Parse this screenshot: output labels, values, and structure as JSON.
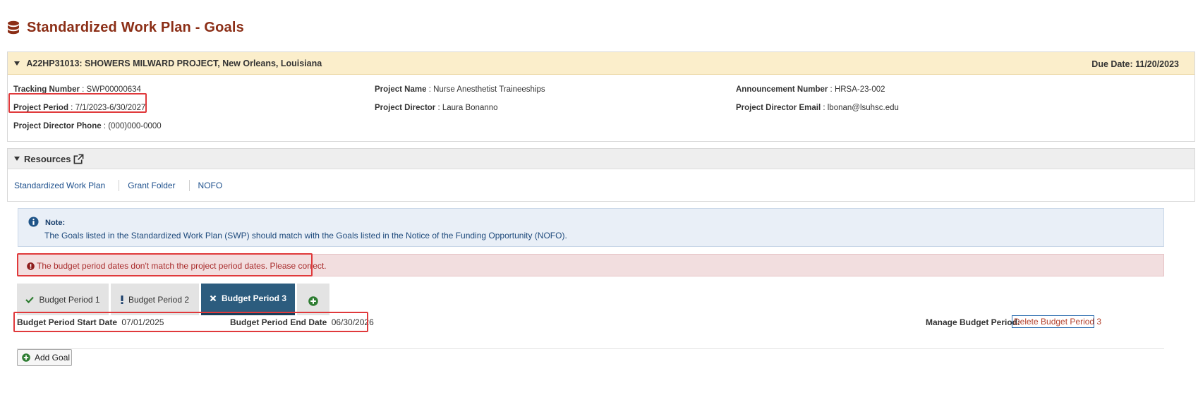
{
  "page": {
    "title": "Standardized Work Plan - Goals"
  },
  "project": {
    "header": "A22HP31013: SHOWERS MILWARD PROJECT, New Orleans, Louisiana",
    "due_date": "Due Date: 11/20/2023",
    "fields": {
      "tracking_number": {
        "label": "Tracking Number",
        "value": "SWP00000634"
      },
      "project_name": {
        "label": "Project Name",
        "value": "Nurse Anesthetist Traineeships"
      },
      "announcement_number": {
        "label": "Announcement Number",
        "value": "HRSA-23-002"
      },
      "project_period": {
        "label": "Project Period",
        "value": "7/1/2023-6/30/2027"
      },
      "project_director": {
        "label": "Project Director",
        "value": "Laura Bonanno"
      },
      "project_director_email": {
        "label": "Project Director Email",
        "value": "lbonan@lsuhsc.edu"
      },
      "project_director_phone": {
        "label": "Project Director Phone",
        "value": "(000)000-0000"
      }
    }
  },
  "resources": {
    "title": "Resources",
    "links": [
      "Standardized Work Plan",
      "Grant Folder",
      "NOFO"
    ]
  },
  "note": {
    "label": "Note:",
    "text": "The Goals listed in the Standardized Work Plan (SWP) should match with the Goals listed in the Notice of the Funding Opportunity (NOFO)."
  },
  "error": {
    "text": "The budget period dates don't match the project period dates. Please correct."
  },
  "tabs": [
    {
      "label": "Budget Period 1",
      "status": "check"
    },
    {
      "label": "Budget Period 2",
      "status": "warning"
    },
    {
      "label": "Budget Period 3",
      "status": "error",
      "active": true
    }
  ],
  "budget_period": {
    "start_label": "Budget Period Start Date",
    "start_value": "07/01/2025",
    "end_label": "Budget Period End Date",
    "end_value": "06/30/2026",
    "manage_label": "Manage Budget Period:",
    "delete_link": "Delete Budget Period 3"
  },
  "actions": {
    "add_goal": "Add Goal"
  },
  "colors": {
    "title": "#8b2e16",
    "project_header_bg": "#fbeecb",
    "note_bg": "#e9eff7",
    "error_bg": "#f2dedf",
    "active_tab": "#2c5c7e",
    "highlight_border": "#e0393b"
  }
}
